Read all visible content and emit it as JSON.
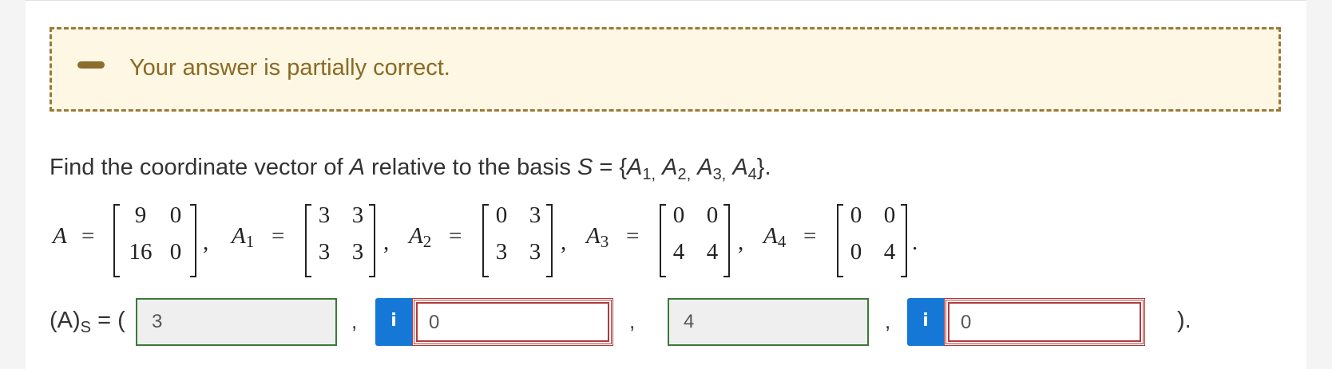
{
  "feedback": {
    "message": "Your answer is partially correct."
  },
  "question": {
    "prefix": "Find the coordinate vector of ",
    "var": "A",
    "middle": " relative to the basis ",
    "basis_var": "S",
    "equals_open": " = {",
    "b1": "A",
    "b1_sub": "1,",
    "b2": "A",
    "b2_sub": "2,",
    "b3": "A",
    "b3_sub": "3,",
    "b4": "A",
    "b4_sub": "4",
    "close": "}."
  },
  "matrices": [
    {
      "label": "A",
      "sub": "",
      "vals": [
        "9",
        "0",
        "16",
        "0"
      ]
    },
    {
      "label": "A",
      "sub": "1",
      "vals": [
        "3",
        "3",
        "3",
        "3"
      ]
    },
    {
      "label": "A",
      "sub": "2",
      "vals": [
        "0",
        "3",
        "3",
        "3"
      ]
    },
    {
      "label": "A",
      "sub": "3",
      "vals": [
        "0",
        "0",
        "4",
        "4"
      ]
    },
    {
      "label": "A",
      "sub": "4",
      "vals": [
        "0",
        "0",
        "0",
        "4"
      ]
    }
  ],
  "math_symbols": {
    "equals": "=",
    "comma": ",",
    "period": "."
  },
  "answer": {
    "prefix": "(A)",
    "prefix_sub": "S",
    "prefix_tail": " = (",
    "fields": [
      {
        "value": "3",
        "status": "correct"
      },
      {
        "value": "0",
        "status": "incorrect"
      },
      {
        "value": "4",
        "status": "correct"
      },
      {
        "value": "0",
        "status": "incorrect"
      }
    ],
    "info_label": "i",
    "separator": ",",
    "suffix": ")."
  },
  "colors": {
    "feedback_border": "#9a7a3a",
    "feedback_bg": "#fdf7e3",
    "correct_border": "#3a7a3a",
    "incorrect_border": "#b03b3b",
    "info_button": "#1577d6"
  }
}
